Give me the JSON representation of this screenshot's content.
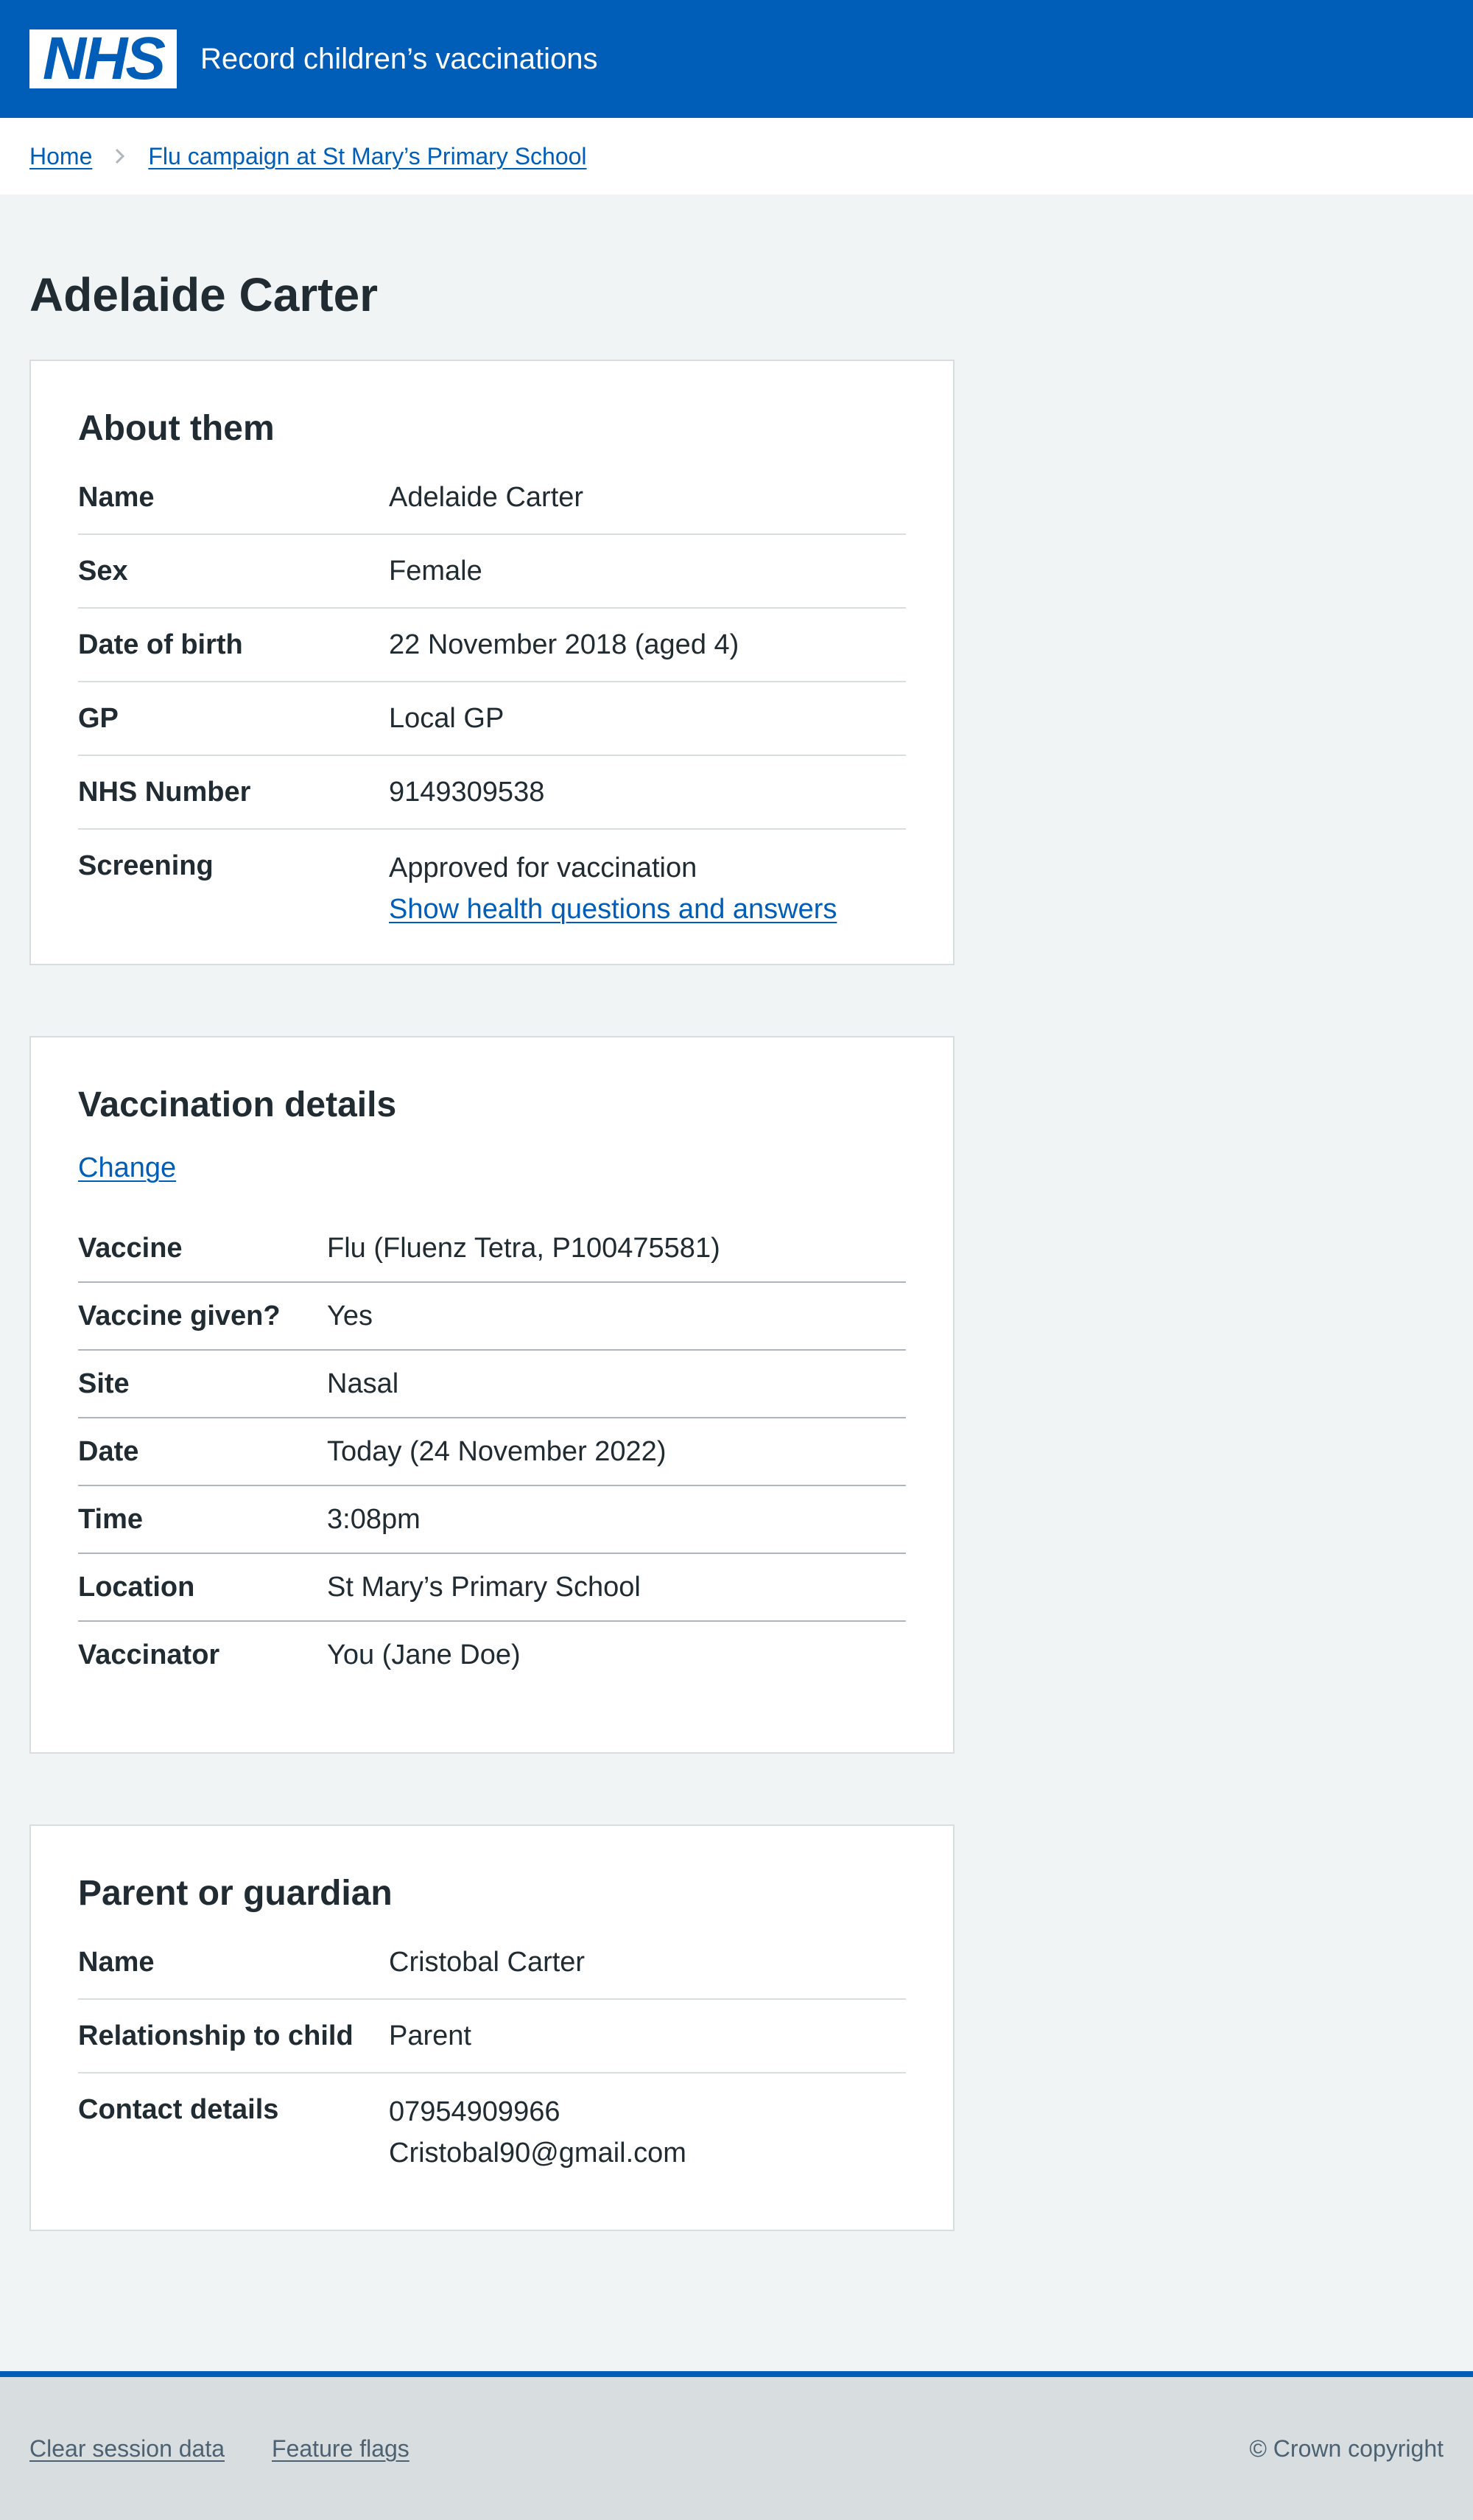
{
  "header": {
    "logo_text": "NHS",
    "service_name": "Record children’s vaccinations"
  },
  "breadcrumb": {
    "home": "Home",
    "campaign": "Flu campaign at St Mary’s Primary School"
  },
  "page_title": "Adelaide Carter",
  "about": {
    "heading": "About them",
    "name_label": "Name",
    "name": "Adelaide Carter",
    "sex_label": "Sex",
    "sex": "Female",
    "dob_label": "Date of birth",
    "dob": "22 November 2018 (aged 4)",
    "gp_label": "GP",
    "gp": "Local GP",
    "nhs_label": "NHS Number",
    "nhs_number": "9149309538",
    "screening_label": "Screening",
    "screening": "Approved for vaccination",
    "health_link": "Show health questions and answers"
  },
  "vaccination": {
    "heading": "Vaccination details",
    "change_link": "Change",
    "vaccine_label": "Vaccine",
    "vaccine": "Flu (Fluenz Tetra, P100475581)",
    "given_label": "Vaccine given?",
    "given": "Yes",
    "site_label": "Site",
    "site": "Nasal",
    "date_label": "Date",
    "date": "Today (24 November 2022)",
    "time_label": "Time",
    "time": "3:08pm",
    "location_label": "Location",
    "location": "St Mary’s Primary School",
    "vaccinator_label": "Vaccinator",
    "vaccinator": "You (Jane Doe)"
  },
  "guardian": {
    "heading": "Parent or guardian",
    "name_label": "Name",
    "name": "Cristobal Carter",
    "relationship_label": "Relationship to child",
    "relationship": "Parent",
    "contact_label": "Contact details",
    "phone": "07954909966",
    "email": "Cristobal90@gmail.com"
  },
  "footer": {
    "clear_session": "Clear session data",
    "feature_flags": "Feature flags",
    "copyright": "© Crown copyright"
  },
  "colors": {
    "nhs_blue": "#005eb8",
    "page_background": "#f0f4f5",
    "text": "#212b32",
    "footer_background": "#d8dde0",
    "footer_text": "#4c6272"
  }
}
